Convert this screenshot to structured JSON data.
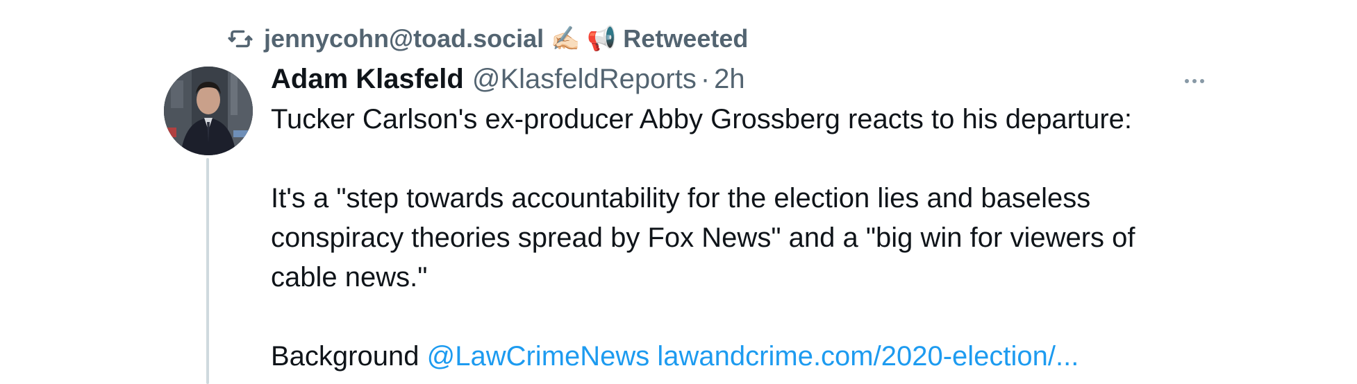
{
  "retweet": {
    "user": "jennycohn@toad.social",
    "emoji": "✍🏻 📢",
    "label": "Retweeted"
  },
  "tweet": {
    "display_name": "Adam Klasfeld",
    "handle": "@KlasfeldReports",
    "separator": "·",
    "time": "2h",
    "paragraphs": [
      "Tucker Carlson's ex-producer Abby Grossberg reacts to his departure:",
      "It's a \"step towards accountability for the election lies and baseless conspiracy theories spread by Fox News\" and a \"big win for viewers of cable news.\""
    ],
    "background_prefix": "Background",
    "mention": "@LawCrimeNews",
    "link": "lawandcrime.com/2020-election/..."
  },
  "icons": {
    "retweet": "retweet-icon",
    "more": "more-horizontal-icon",
    "avatar": "user-avatar"
  },
  "colors": {
    "text_primary": "#0f1419",
    "text_secondary": "#536471",
    "link": "#1d9bf0",
    "thread_line": "#cfd9de"
  }
}
